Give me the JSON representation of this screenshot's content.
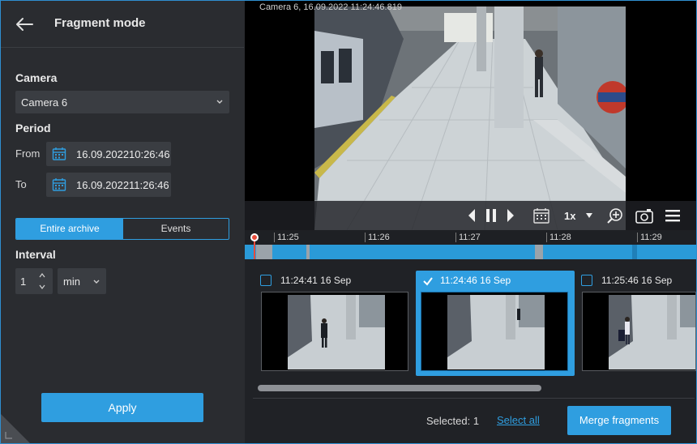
{
  "header": {
    "title": "Fragment mode"
  },
  "camera": {
    "section_label": "Camera",
    "selected": "Camera 6"
  },
  "period": {
    "section_label": "Period",
    "from_label": "From",
    "from_date": "16.09.2022",
    "from_time": "10:26:46",
    "to_label": "To",
    "to_date": "16.09.2022",
    "to_time": "11:26:46"
  },
  "mode_toggle": {
    "entire_archive": "Entire archive",
    "events": "Events",
    "active": "Entire archive"
  },
  "interval": {
    "section_label": "Interval",
    "value": "1",
    "unit": "min"
  },
  "apply_label": "Apply",
  "video": {
    "overlay_text": "Camera 6, 16.09.2022 11:24:46.819",
    "speed": "1x"
  },
  "timeline": {
    "ticks": [
      "11:25",
      "11:26",
      "11:27",
      "11:28",
      "11:29"
    ]
  },
  "fragments": [
    {
      "timestamp": "11:24:41 16 Sep",
      "checked": false
    },
    {
      "timestamp": "11:24:46 16 Sep",
      "checked": true
    },
    {
      "timestamp": "11:25:46 16 Sep",
      "checked": false
    }
  ],
  "footer": {
    "selected_text": "Selected: 1",
    "select_all": "Select all",
    "merge": "Merge fragments"
  },
  "colors": {
    "accent": "#2f9ee0",
    "panel": "#2a2c30",
    "field": "#3a3d42",
    "playhead": "#e74c3c"
  }
}
